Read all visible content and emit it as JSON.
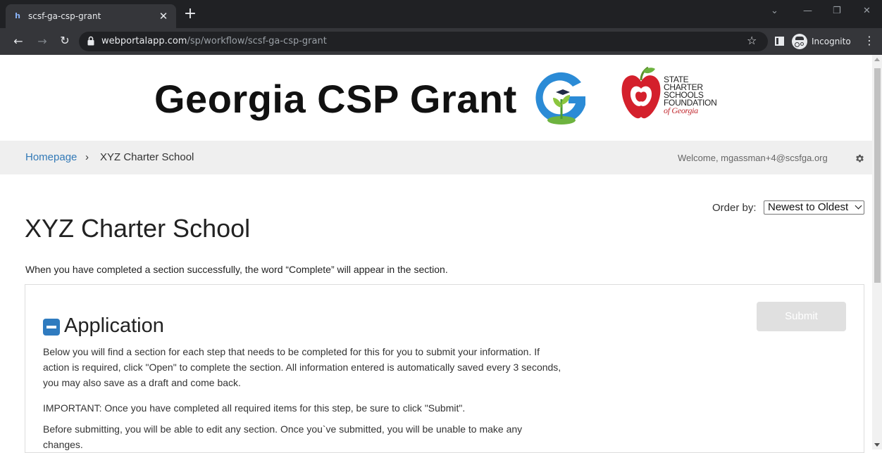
{
  "browser": {
    "tab_title": "scsf-ga-csp-grant",
    "tab_favicon": "h",
    "close_glyph": "✕",
    "new_tab_glyph": "+",
    "url_host": "webportalapp.com",
    "url_path": "/sp/workflow/scsf-ga-csp-grant",
    "incognito_label": "Incognito",
    "icons": [
      "back-icon",
      "forward-icon",
      "reload-icon",
      "lock-icon",
      "star-icon",
      "side-panel-icon",
      "incognito-icon",
      "menu-icon"
    ]
  },
  "banner": {
    "title": "Georgia CSP Grant",
    "scsf_lines": [
      "STATE",
      "CHARTER",
      "SCHOOLS",
      "FOUNDATION"
    ],
    "scsf_ga": "of Georgia"
  },
  "breadcrumb": {
    "home": "Homepage",
    "separator": "›",
    "current": "XYZ Charter School",
    "welcome": "Welcome, mgassman+4@scsfga.org"
  },
  "order": {
    "label": "Order by:",
    "selected": "Newest to Oldest"
  },
  "page": {
    "title": "XYZ Charter School",
    "intro": "When you have completed a section successfully, the word “Complete” will appear in the section."
  },
  "section": {
    "title": "Application",
    "submit_label": "Submit",
    "paragraph1": "Below you will find a section for each step that needs to be completed for this for you to submit your information. If action is required, click \"Open\" to complete the section. All information entered is automatically saved every 3 seconds, you may also save as a draft and come back.",
    "paragraph2": "IMPORTANT: Once you have completed all required items for this step, be sure to click \"Submit\".",
    "paragraph3": "Before submitting, you will be able to edit any section. Once you`ve submitted, you will be unable to make any changes."
  },
  "colors": {
    "link": "#337ab7",
    "accent_blue": "#2f7bbf",
    "apple_red": "#c1272d",
    "submit_disabled": "#e0e0e0"
  }
}
